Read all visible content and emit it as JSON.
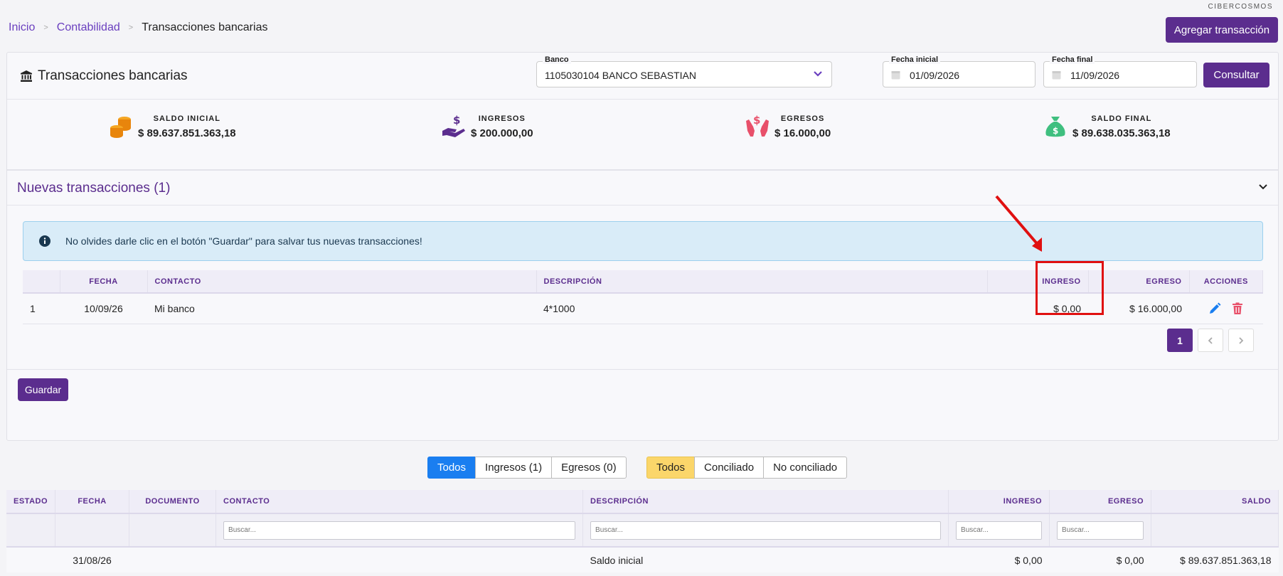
{
  "brand": "CIBERCOSMOS",
  "breadcrumb": {
    "items": [
      "Inicio",
      "Contabilidad"
    ],
    "current": "Transacciones bancarias"
  },
  "add_button": "Agregar transacción",
  "header": {
    "title": "Transacciones bancarias",
    "bank_label": "Banco",
    "bank_value": "1105030104 BANCO SEBASTIAN",
    "start_label": "Fecha inicial",
    "start_value": "01/09/2026",
    "end_label": "Fecha final",
    "end_value": "11/09/2026",
    "consult_button": "Consultar"
  },
  "summary": [
    {
      "label": "SALDO INICIAL",
      "value": "$ 89.637.851.363,18",
      "icon": "coins-icon",
      "color": "#e8850c"
    },
    {
      "label": "INGRESOS",
      "value": "$ 200.000,00",
      "icon": "hand-dollar-icon",
      "color": "#5b2d8e"
    },
    {
      "label": "EGRESOS",
      "value": "$ 16.000,00",
      "icon": "hands-dollar-icon",
      "color": "#e8506a"
    },
    {
      "label": "SALDO FINAL",
      "value": "$ 89.638.035.363,18",
      "icon": "money-bag-icon",
      "color": "#3fbf7f"
    }
  ],
  "new_transactions": {
    "title": "Nuevas transacciones (1)",
    "alert": "No olvides darle clic en el botón \"Guardar\" para salvar tus nuevas transacciones!",
    "columns": [
      "",
      "FECHA",
      "CONTACTO",
      "DESCRIPCIÓN",
      "INGRESO",
      "EGRESO",
      "ACCIONES"
    ],
    "rows": [
      {
        "num": "1",
        "fecha": "10/09/26",
        "contacto": "Mi banco",
        "descripcion": "4*1000",
        "ingreso": "$ 0,00",
        "egreso": "$ 16.000,00"
      }
    ],
    "page": "1",
    "save_button": "Guardar"
  },
  "filters": {
    "type": [
      "Todos",
      "Ingresos (1)",
      "Egresos (0)"
    ],
    "status": [
      "Todos",
      "Conciliado",
      "No conciliado"
    ]
  },
  "main_table": {
    "columns": [
      "ESTADO",
      "FECHA",
      "DOCUMENTO",
      "CONTACTO",
      "DESCRIPCIÓN",
      "INGRESO",
      "EGRESO",
      "SALDO"
    ],
    "search_placeholder": "Buscar...",
    "rows": [
      {
        "estado": "",
        "fecha": "31/08/26",
        "documento": "",
        "contacto": "",
        "descripcion": "Saldo inicial",
        "ingreso": "$ 0,00",
        "egreso": "$ 0,00",
        "saldo": "$ 89.637.851.363,18"
      }
    ]
  }
}
